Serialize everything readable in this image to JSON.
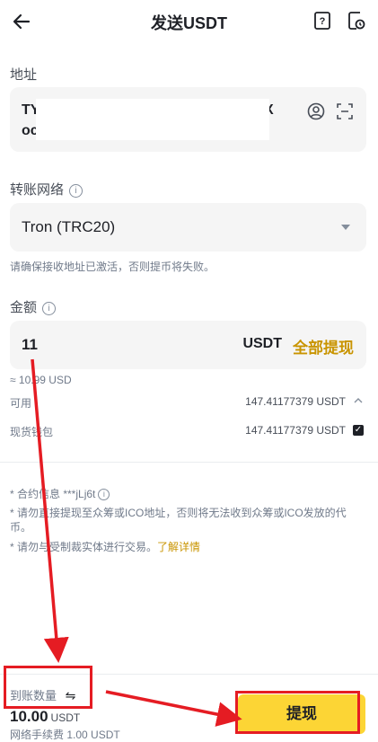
{
  "header": {
    "title": "发送USDT",
    "back_icon": "back-arrow-icon",
    "help_icon": "help-doc-icon",
    "history_icon": "history-icon"
  },
  "address": {
    "label": "地址",
    "value_start": "TY",
    "value_end": "KX",
    "value_line2": "oc",
    "contact_icon": "address-book-icon",
    "scan_icon": "scan-icon"
  },
  "network": {
    "label": "转账网络",
    "selected": "Tron (TRC20)",
    "hint": "请确保接收地址已激活，否则提币将失败。"
  },
  "amount": {
    "label": "金额",
    "value": "11",
    "unit": "USDT",
    "max_label": "全部提现",
    "usd_estimate": "≈ 10.99 USD"
  },
  "balance": {
    "available_label": "可用",
    "available_value": "147.41177379 USDT",
    "spot_label": "现货钱包",
    "spot_value": "147.41177379 USDT"
  },
  "notices": {
    "contract": "* 合约信息 ***jLj6t",
    "ico": "* 请勿直接提现至众筹或ICO地址，否则将无法收到众筹或ICO发放的代币。",
    "sanction": "* 请勿与受制裁实体进行交易。",
    "sanction_link": "了解详情"
  },
  "footer": {
    "receive_label": "到账数量",
    "receive_amount": "10.00",
    "receive_unit": "USDT",
    "fee_text": "网络手续费 1.00 USDT",
    "withdraw_label": "提现"
  },
  "colors": {
    "accent": "#fcd535",
    "link": "#c99400",
    "annotation": "#e51c23"
  }
}
